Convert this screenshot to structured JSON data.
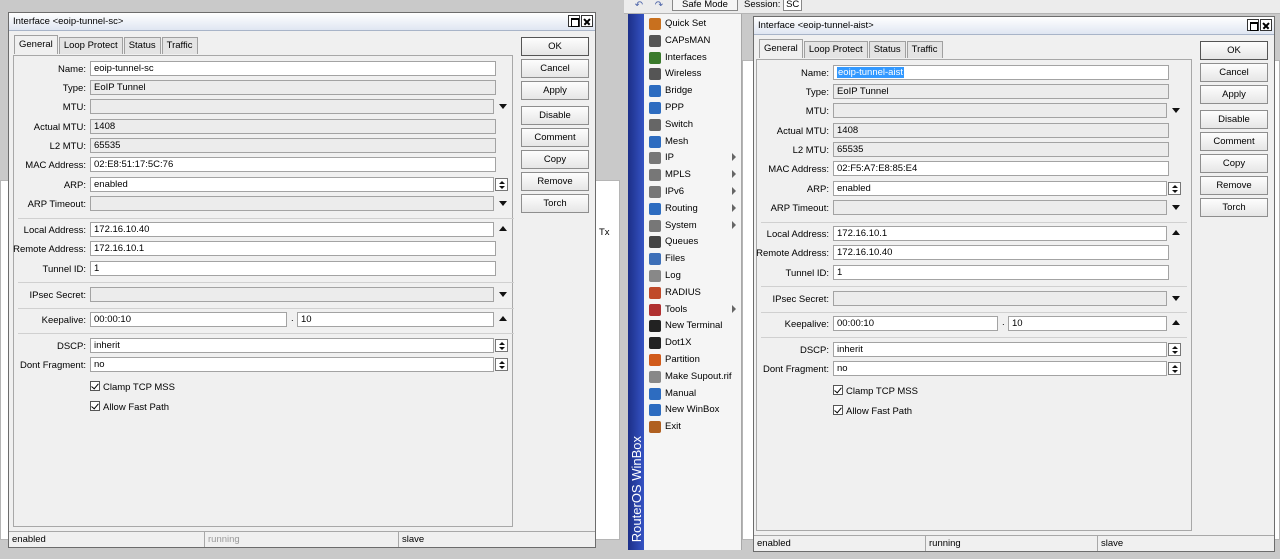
{
  "topbar": {
    "undo_icon": "undo-icon",
    "redo_icon": "redo-icon",
    "safe_mode": "Safe Mode",
    "session_label": "Session:",
    "session_value": "SC"
  },
  "sidebar": {
    "brand": "RouterOS WinBox",
    "items": [
      {
        "label": "Quick Set",
        "icon": "quickset-icon",
        "color": "#c8701e",
        "arrow": false
      },
      {
        "label": "CAPsMAN",
        "icon": "antenna-icon",
        "color": "#555555",
        "arrow": false
      },
      {
        "label": "Interfaces",
        "icon": "interfaces-icon",
        "color": "#3a7a2c",
        "arrow": false
      },
      {
        "label": "Wireless",
        "icon": "wireless-icon",
        "color": "#555555",
        "arrow": false
      },
      {
        "label": "Bridge",
        "icon": "bridge-icon",
        "color": "#2d6cc0",
        "arrow": false
      },
      {
        "label": "PPP",
        "icon": "ppp-icon",
        "color": "#2d6cc0",
        "arrow": false
      },
      {
        "label": "Switch",
        "icon": "switch-icon",
        "color": "#666666",
        "arrow": false
      },
      {
        "label": "Mesh",
        "icon": "mesh-icon",
        "color": "#2d6cc0",
        "arrow": false
      },
      {
        "label": "IP",
        "icon": "ip-icon",
        "color": "#777777",
        "arrow": true
      },
      {
        "label": "MPLS",
        "icon": "mpls-icon",
        "color": "#777777",
        "arrow": true
      },
      {
        "label": "IPv6",
        "icon": "ipv6-icon",
        "color": "#777777",
        "arrow": true
      },
      {
        "label": "Routing",
        "icon": "routing-icon",
        "color": "#2d6cc0",
        "arrow": true
      },
      {
        "label": "System",
        "icon": "system-icon",
        "color": "#777777",
        "arrow": true
      },
      {
        "label": "Queues",
        "icon": "queues-icon",
        "color": "#444444",
        "arrow": false
      },
      {
        "label": "Files",
        "icon": "files-icon",
        "color": "#3d6fb8",
        "arrow": false
      },
      {
        "label": "Log",
        "icon": "log-icon",
        "color": "#888888",
        "arrow": false
      },
      {
        "label": "RADIUS",
        "icon": "radius-icon",
        "color": "#c04a2a",
        "arrow": false
      },
      {
        "label": "Tools",
        "icon": "tools-icon",
        "color": "#b03030",
        "arrow": true
      },
      {
        "label": "New Terminal",
        "icon": "terminal-icon",
        "color": "#222222",
        "arrow": false
      },
      {
        "label": "Dot1X",
        "icon": "dot1x-icon",
        "color": "#222222",
        "arrow": false
      },
      {
        "label": "Partition",
        "icon": "partition-icon",
        "color": "#d05a1a",
        "arrow": false
      },
      {
        "label": "Make Supout.rif",
        "icon": "supout-icon",
        "color": "#888888",
        "arrow": false
      },
      {
        "label": "Manual",
        "icon": "manual-icon",
        "color": "#2d6cc0",
        "arrow": false
      },
      {
        "label": "New WinBox",
        "icon": "winbox-icon",
        "color": "#2d6cc0",
        "arrow": false
      },
      {
        "label": "Exit",
        "icon": "exit-icon",
        "color": "#b06020",
        "arrow": false
      }
    ]
  },
  "left_bg": {
    "col_tx": "Tx"
  },
  "tabs": [
    "General",
    "Loop Protect",
    "Status",
    "Traffic"
  ],
  "buttons": [
    "OK",
    "Cancel",
    "Apply",
    "Disable",
    "Comment",
    "Copy",
    "Remove",
    "Torch"
  ],
  "labels": {
    "name": "Name:",
    "type": "Type:",
    "mtu": "MTU:",
    "actual_mtu": "Actual MTU:",
    "l2_mtu": "L2 MTU:",
    "mac": "MAC Address:",
    "arp": "ARP:",
    "arp_timeout": "ARP Timeout:",
    "local": "Local Address:",
    "remote": "Remote Address:",
    "tunnel_id": "Tunnel ID:",
    "ipsec": "IPsec Secret:",
    "keepalive": "Keepalive:",
    "dscp": "DSCP:",
    "dont_frag": "Dont Fragment:",
    "clamp": "Clamp TCP MSS",
    "fast_path": "Allow Fast Path",
    "dot": "."
  },
  "win1": {
    "title": "Interface <eoip-tunnel-sc>",
    "name": "eoip-tunnel-sc",
    "type": "EoIP Tunnel",
    "mtu": "",
    "actual_mtu": "1408",
    "l2_mtu": "65535",
    "mac": "02:E8:51:17:5C:76",
    "arp": "enabled",
    "arp_timeout": "",
    "local": "172.16.10.40",
    "remote": "172.16.10.1",
    "tunnel_id": "1",
    "ipsec": "",
    "keepalive": "00:00:10",
    "keepalive_retries": "10",
    "dscp": "inherit",
    "dont_frag": "no",
    "clamp": true,
    "fast_path": true,
    "status": [
      "enabled",
      "running",
      "slave"
    ]
  },
  "win2": {
    "title": "Interface <eoip-tunnel-aist>",
    "name": "eoip-tunnel-aist",
    "type": "EoIP Tunnel",
    "mtu": "",
    "actual_mtu": "1408",
    "l2_mtu": "65535",
    "mac": "02:F5:A7:E8:85:E4",
    "arp": "enabled",
    "arp_timeout": "",
    "local": "172.16.10.1",
    "remote": "172.16.10.40",
    "tunnel_id": "1",
    "ipsec": "",
    "keepalive": "00:00:10",
    "keepalive_retries": "10",
    "dscp": "inherit",
    "dont_frag": "no",
    "clamp": true,
    "fast_path": true,
    "status": [
      "enabled",
      "running",
      "slave"
    ]
  }
}
